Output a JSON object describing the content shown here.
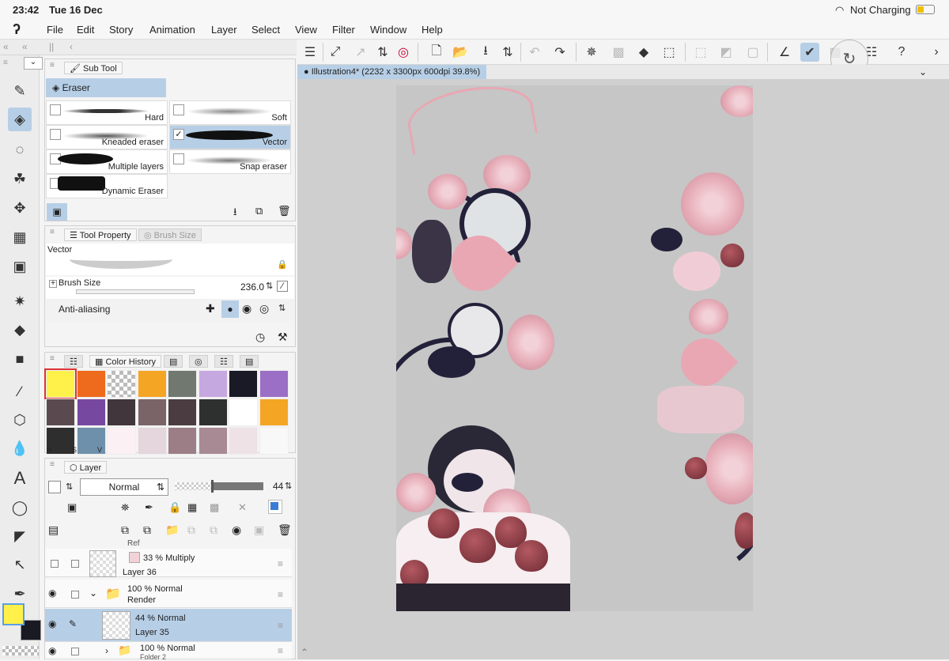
{
  "status": {
    "time": "23:42",
    "date": "Tue 16 Dec",
    "battery": "Not Charging"
  },
  "menu": [
    "File",
    "Edit",
    "Story",
    "Animation",
    "Layer",
    "Select",
    "View",
    "Filter",
    "Window",
    "Help"
  ],
  "document_tab": "Illustration4* (2232 x 3300px 600dpi 39.8%)",
  "subtool_panel": {
    "tab": "Sub Tool",
    "group": "Eraser",
    "items": [
      {
        "label": "Hard",
        "checked": false
      },
      {
        "label": "Soft",
        "checked": false
      },
      {
        "label": "Kneaded eraser",
        "checked": false
      },
      {
        "label": "Vector",
        "checked": true
      },
      {
        "label": "Multiple layers",
        "checked": false
      },
      {
        "label": "Snap eraser",
        "checked": false
      },
      {
        "label": "Dynamic Eraser",
        "checked": false
      }
    ]
  },
  "tool_property": {
    "tabs": [
      "Tool Property",
      "Brush Size"
    ],
    "preset": "Vector",
    "brush_size_label": "Brush Size",
    "brush_size_value": "236.0",
    "anti_aliasing_label": "Anti-aliasing"
  },
  "color_panel": {
    "tab": "Color History",
    "swatches": [
      "#fff04a",
      "#ee6a1c",
      "checker",
      "#f5a524",
      "#707870",
      "#c6a8e0",
      "#191a26",
      "#9b6fc6",
      "#5a4a50",
      "#7648a0",
      "#40363c",
      "#7a6468",
      "#4a3c40",
      "#2e3030",
      "#ffffff",
      "#f5a524",
      "#2e2e2e",
      "#6e90aa",
      "#fbf0f4",
      "#e4d6dc",
      "#9c7e86",
      "#a88a94",
      "#efe2e6",
      "#f8f8f8"
    ],
    "hsv": [
      "H",
      "S",
      "V"
    ]
  },
  "layer_panel": {
    "tab": "Layer",
    "blend_mode": "Normal",
    "opacity": "44",
    "clipped_name": "Ref",
    "layers": [
      {
        "opacity_mode": "33 % Multiply",
        "name": "Layer 36",
        "visible": false,
        "selected": false
      },
      {
        "opacity_mode": "100 % Normal",
        "name": "Render",
        "visible": true,
        "selected": false,
        "folder": true
      },
      {
        "opacity_mode": "44 % Normal",
        "name": "Layer 35",
        "visible": true,
        "selected": true
      },
      {
        "opacity_mode": "100 % Normal",
        "name": "Folder 2",
        "visible": true,
        "selected": false,
        "folder": true
      }
    ]
  },
  "colors": {
    "main": "#fff04a",
    "sub": "#1a1a24",
    "accent": "#b7cfe6"
  }
}
